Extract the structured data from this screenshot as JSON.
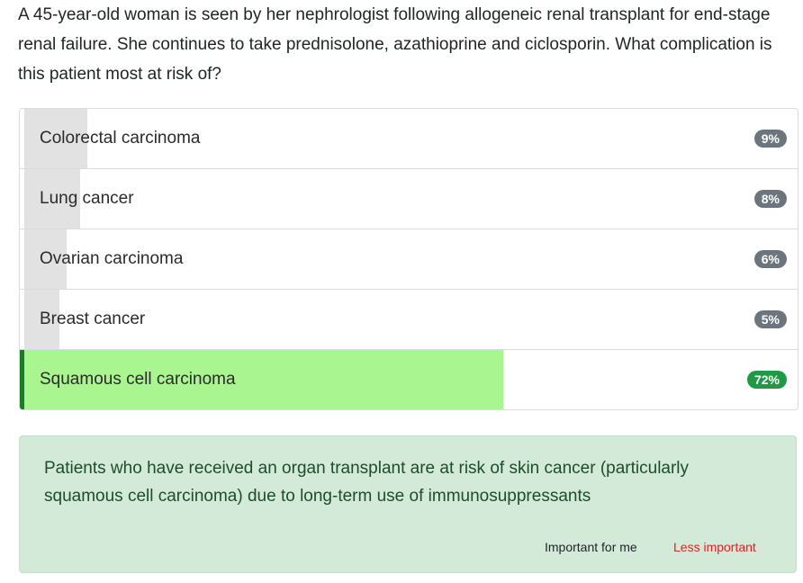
{
  "question": "A 45-year-old woman is seen by her nephrologist following allogeneic renal transplant for end-stage renal failure. She continues to take prednisolone, azathioprine and ciclosporin. What complication is this patient most at risk of?",
  "options": [
    {
      "label": "Colorectal carcinoma",
      "percent_label": "9%",
      "percent": 9,
      "correct": false
    },
    {
      "label": "Lung cancer",
      "percent_label": "8%",
      "percent": 8,
      "correct": false
    },
    {
      "label": "Ovarian carcinoma",
      "percent_label": "6%",
      "percent": 6,
      "correct": false
    },
    {
      "label": "Breast cancer",
      "percent_label": "5%",
      "percent": 5,
      "correct": false
    },
    {
      "label": "Squamous cell carcinoma",
      "percent_label": "72%",
      "percent": 72,
      "correct": true
    }
  ],
  "explanation": {
    "text": "Patients who have received an organ transplant are at risk of skin cancer (particularly squamous cell carcinoma) due to long-term use of immunosuppressants",
    "important_label": "Important for me",
    "less_important_label": "Less important"
  },
  "colors": {
    "correct_fill": "#a9f58f",
    "correct_border": "#1e7a2b",
    "badge_grey": "#6c757d",
    "badge_green": "#1f9a44",
    "explanation_bg": "#d4ead9",
    "less_important": "#e02020"
  }
}
